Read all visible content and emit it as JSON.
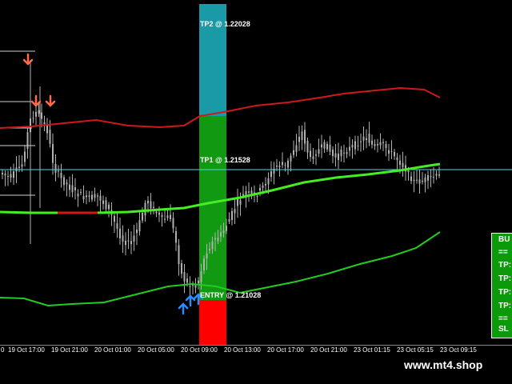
{
  "chart_labels": {
    "tp2": "TP2 @ 1.22028",
    "tp1": "TP1 @ 1.21528",
    "entry": "ENTRY @ 1.21028"
  },
  "time_axis": {
    "ticks": [
      "0",
      "19 Oct 17:00",
      "19 Oct 21:00",
      "20 Oct 01:00",
      "20 Oct 05:00",
      "20 Oct 09:00",
      "20 Oct 13:00",
      "20 Oct 17:00",
      "20 Oct 21:00",
      "23 Oct 01:15",
      "23 Oct 05:15",
      "23 Oct 09:15"
    ]
  },
  "signal_panel": {
    "lines": [
      "BU",
      "==",
      "TP:",
      "TP:",
      "TP:",
      "TP:",
      "==",
      "SL"
    ]
  },
  "watermark": "www.mt4.shop",
  "colors": {
    "background": "#000000",
    "upper_band": "#cc1a1a",
    "middle_band": "#44ee22",
    "lower_band": "#22cc22",
    "tp1_line": "#4fd6e6",
    "tp2_zone": "#1a9aa6",
    "profit_zone": "#119a11",
    "loss_zone": "#ff0000",
    "sell_arrow": "#ff6a4a",
    "buy_arrow": "#2a8cff",
    "candles": "#b0b0b0"
  }
}
